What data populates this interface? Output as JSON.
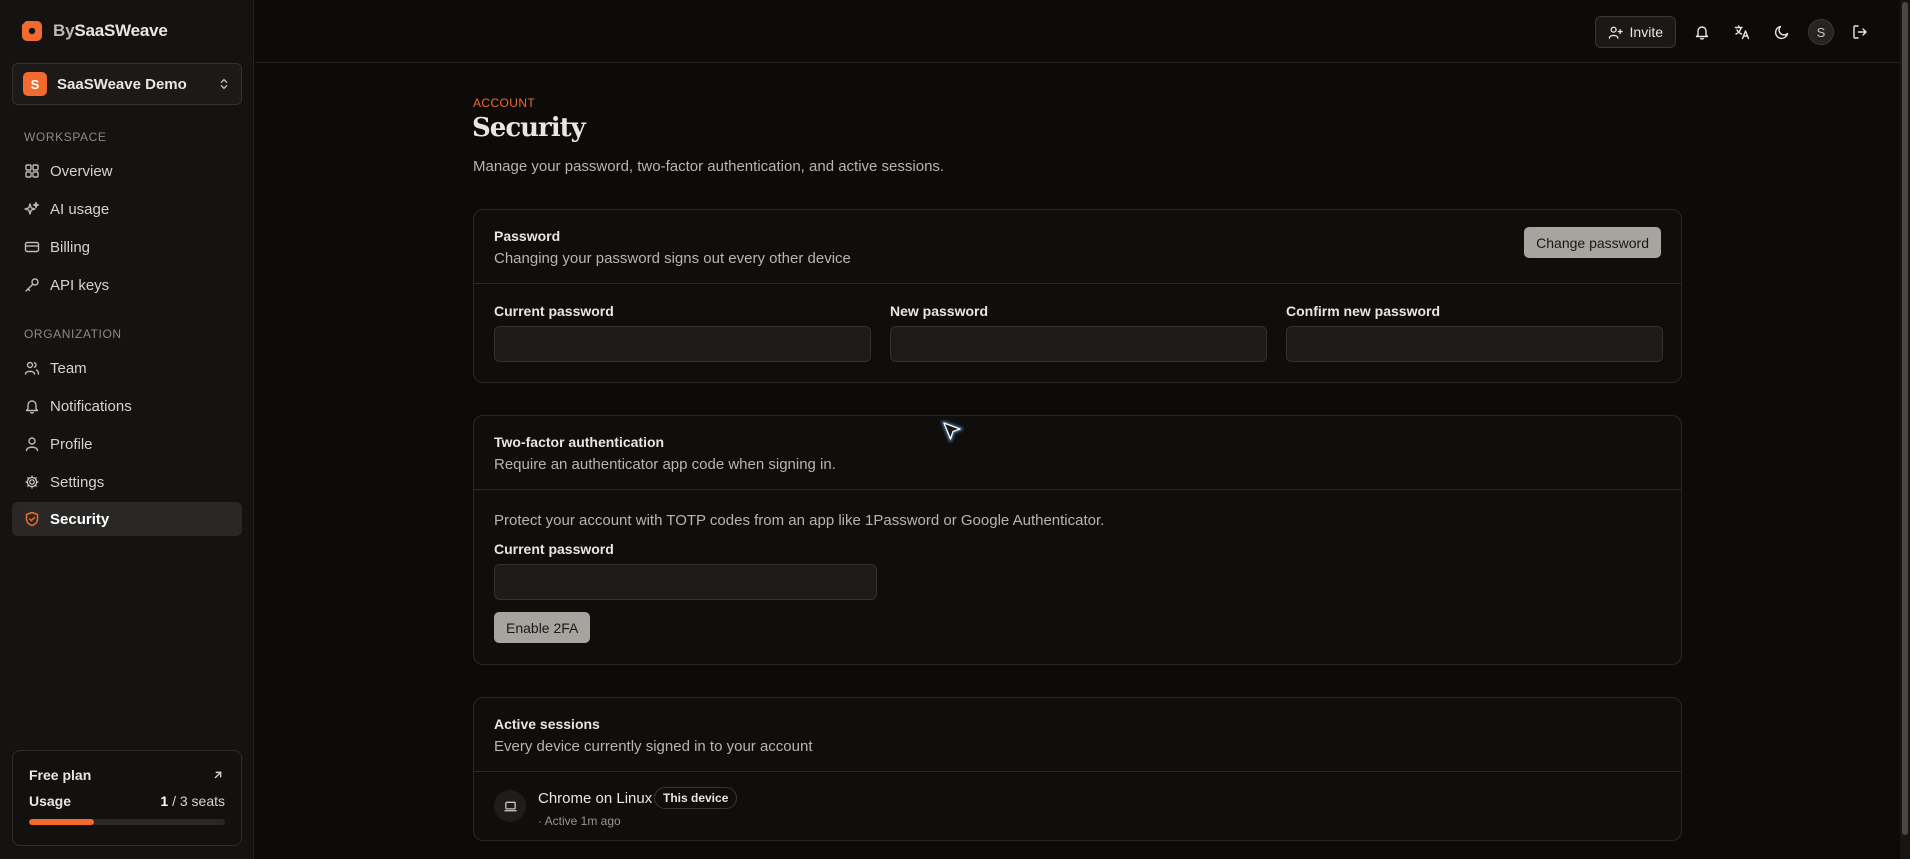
{
  "brand": {
    "prefix": "By",
    "name": "SaaSWeave"
  },
  "workspace": {
    "initial": "S",
    "name": "SaaSWeave Demo"
  },
  "sidebar": {
    "workspace_label": "WORKSPACE",
    "workspace_items": [
      {
        "label": "Overview",
        "icon": "grid-icon"
      },
      {
        "label": "AI usage",
        "icon": "sparkles-icon"
      },
      {
        "label": "Billing",
        "icon": "credit-card-icon"
      },
      {
        "label": "API keys",
        "icon": "key-icon"
      }
    ],
    "org_label": "ORGANIZATION",
    "org_items": [
      {
        "label": "Team",
        "icon": "users-icon"
      },
      {
        "label": "Notifications",
        "icon": "bell-icon"
      },
      {
        "label": "Profile",
        "icon": "user-icon"
      },
      {
        "label": "Settings",
        "icon": "gear-icon"
      },
      {
        "label": "Security",
        "icon": "shield-icon",
        "active": true
      }
    ]
  },
  "plan": {
    "title": "Free plan",
    "usage_label": "Usage",
    "used": "1",
    "total_text": "/ 3 seats",
    "fraction": 0.333
  },
  "topbar": {
    "invite_label": "Invite",
    "avatar_initial": "S"
  },
  "page": {
    "eyebrow": "ACCOUNT",
    "title": "Security",
    "subtitle": "Manage your password, two-factor authentication, and active sessions."
  },
  "password_card": {
    "title": "Password",
    "desc": "Changing your password signs out every other device",
    "button": "Change password",
    "fields": [
      {
        "label": "Current password",
        "value": ""
      },
      {
        "label": "New password",
        "value": ""
      },
      {
        "label": "Confirm new password",
        "value": ""
      }
    ]
  },
  "twofa_card": {
    "title": "Two-factor authentication",
    "desc": "Require an authenticator app code when signing in.",
    "info": "Protect your account with TOTP codes from an app like 1Password or Google Authenticator.",
    "field_label": "Current password",
    "field_value": "",
    "button": "Enable 2FA"
  },
  "sessions_card": {
    "title": "Active sessions",
    "desc": "Every device currently signed in to your account",
    "sessions": [
      {
        "device": "Chrome on Linux",
        "badge": "This device",
        "meta": "· Active 1m ago",
        "icon": "laptop-icon"
      }
    ]
  },
  "colors": {
    "accent": "#f26a2e",
    "background": "#0c0b0a",
    "sidebar": "#141312"
  }
}
